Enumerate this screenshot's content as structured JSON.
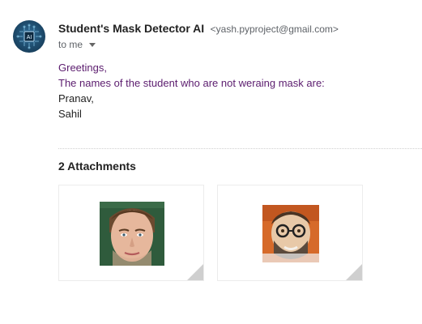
{
  "sender": {
    "name": "Student's Mask Detector AI",
    "email": "<yash.pyproject@gmail.com>",
    "to": "to me",
    "avatar_label": "AI"
  },
  "message": {
    "greeting": "Greetings,",
    "intro": "The names of the student who are not weraing mask are:",
    "names": [
      "Pranav,",
      "Sahil"
    ]
  },
  "attachments": {
    "title": "2 Attachments",
    "items": [
      {
        "icon": "face-image-icon"
      },
      {
        "icon": "face-image-icon"
      }
    ]
  },
  "colors": {
    "purple_text": "#5b1c6e",
    "avatar_bg": "#1d4a6b"
  }
}
